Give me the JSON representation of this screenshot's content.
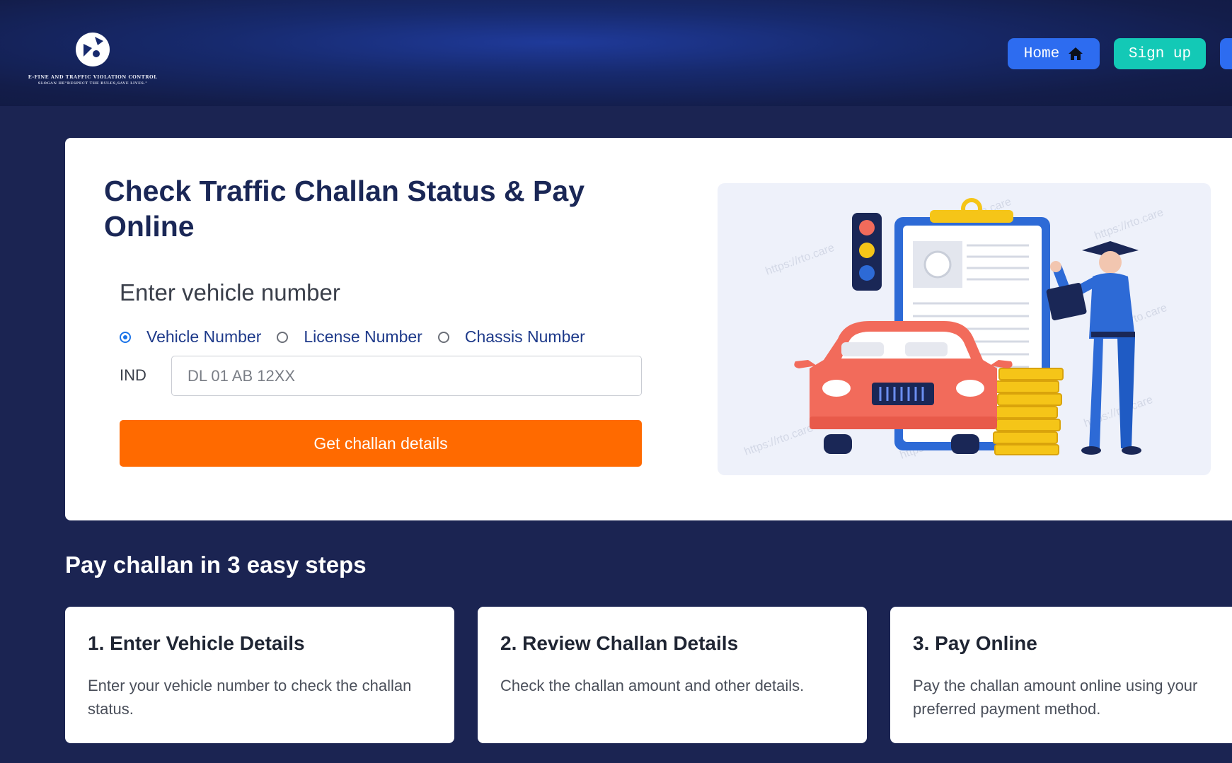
{
  "header": {
    "logo_line1": "E-FINE AND TRAFFIC VIOLATION CONTROL",
    "logo_line2": "SLOGAN HE\"RESPECT THE RULES,SAVE LIVES.\"",
    "nav": {
      "home_label": "Home",
      "signup_label": "Sign up"
    }
  },
  "hero": {
    "title": "Check Traffic Challan Status & Pay Online",
    "form_heading": "Enter vehicle number",
    "radio_options": [
      {
        "label": "Vehicle Number",
        "checked": true
      },
      {
        "label": "License Number",
        "checked": false
      },
      {
        "label": "Chassis Number",
        "checked": false
      }
    ],
    "prefix": "IND",
    "input_placeholder": "DL 01 AB 12XX",
    "input_value": "",
    "submit_label": "Get challan details",
    "watermark": "https://rto.care"
  },
  "steps": {
    "title": "Pay challan in 3 easy steps",
    "items": [
      {
        "title": "1. Enter Vehicle Details",
        "desc": "Enter your vehicle number to check the challan status."
      },
      {
        "title": "2. Review Challan Details",
        "desc": "Check the challan amount and other details."
      },
      {
        "title": "3. Pay Online",
        "desc": "Pay the challan amount online using your preferred payment method."
      }
    ]
  },
  "colors": {
    "page_bg": "#1b2452",
    "header_accent": "#1f3a9a",
    "home_button": "#2d6cf0",
    "signup_button": "#13c9b6",
    "submit_button": "#ff6a00",
    "title_text": "#1a2756"
  },
  "icons": {
    "home": "home-icon",
    "logo": "logo-mark-icon"
  }
}
